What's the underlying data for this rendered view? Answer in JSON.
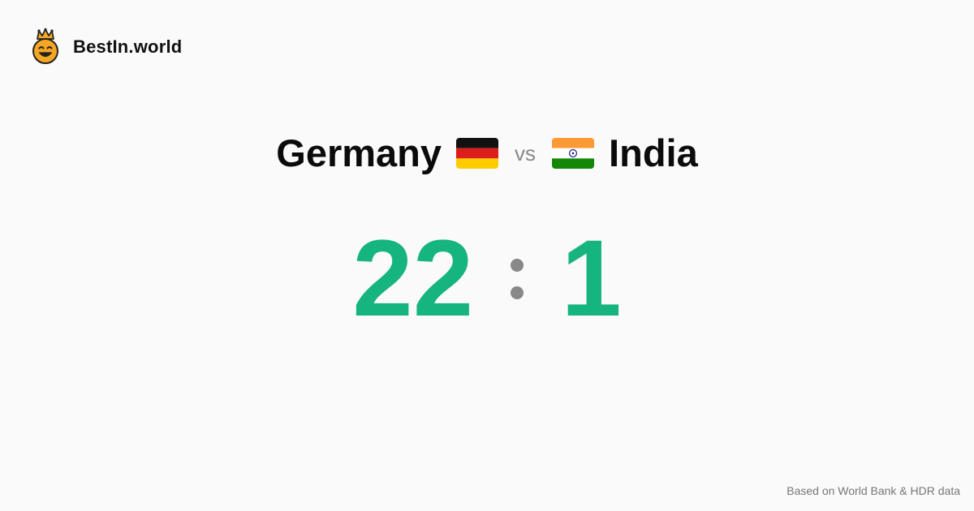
{
  "brand": {
    "name": "BestIn.world",
    "logo_icon": "crown-smiley-icon"
  },
  "comparison": {
    "left_country": "Germany",
    "left_flag_icon": "germany-flag-icon",
    "vs_label": "vs",
    "right_country": "India",
    "right_flag_icon": "india-flag-icon"
  },
  "score": {
    "left": "22",
    "right": "1",
    "separator_icon": "colon-dots-icon",
    "color": "#16b47e"
  },
  "footer": {
    "source": "Based on World Bank & HDR data"
  },
  "colors": {
    "background": "#fafafa",
    "score_green": "#16b47e",
    "muted_gray": "#888888"
  }
}
